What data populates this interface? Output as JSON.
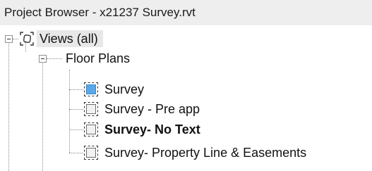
{
  "window": {
    "title": "Project Browser - x21237 Survey.rvt"
  },
  "tree": {
    "root": {
      "label": "Views (all)",
      "icon": "views-icon",
      "expanded": true
    },
    "group": {
      "label": "Floor Plans",
      "expanded": true
    },
    "items": [
      {
        "label": "Survey",
        "icon": "floor-plan-view-icon",
        "active": true,
        "bold": false
      },
      {
        "label": "Survey - Pre app",
        "icon": "floor-plan-view-icon",
        "active": false,
        "bold": false
      },
      {
        "label": "Survey- No Text",
        "icon": "floor-plan-view-icon",
        "active": false,
        "bold": true
      },
      {
        "label": "Survey- Property Line & Easements",
        "icon": "floor-plan-view-icon",
        "active": false,
        "bold": false
      }
    ]
  }
}
